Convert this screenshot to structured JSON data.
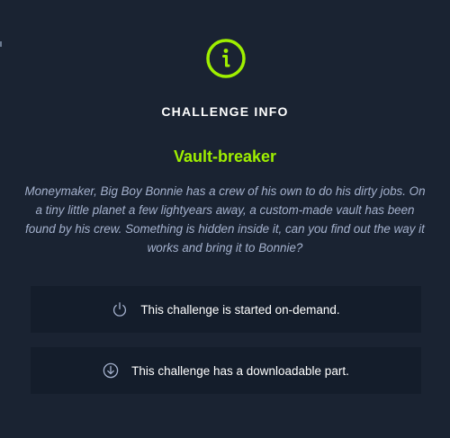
{
  "challenge_info": {
    "heading": "CHALLENGE INFO",
    "name": "Vault-breaker",
    "description": "Moneymaker, Big Boy Bonnie has a crew of his own to do his dirty jobs. On a tiny little planet a few lightyears away, a custom-made vault has been found by his crew. Something is hidden inside it, can you find out the way it works and bring it to Bonnie?",
    "icon": "info-icon"
  },
  "features": [
    {
      "icon": "power-icon",
      "text": "This challenge is started on-demand."
    },
    {
      "icon": "download-icon",
      "text": "This challenge has a downloadable part."
    }
  ],
  "colors": {
    "background": "#1a2332",
    "card_background": "#141d2b",
    "accent": "#9fef00",
    "description_text": "#a4b1cd",
    "text": "#ffffff"
  }
}
